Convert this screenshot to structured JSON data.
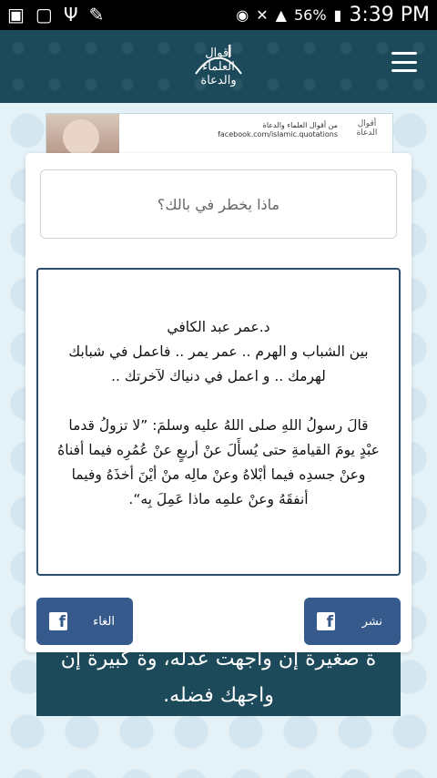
{
  "status_bar": {
    "left_icons": [
      "briefcase-icon",
      "chat-icon",
      "usb-icon",
      "pen-icon"
    ],
    "battery_percent": "56%",
    "time": "3:39 PM"
  },
  "header": {
    "logo_lines": [
      "أقوال",
      "العلماء",
      "والدعاة"
    ],
    "menu_icon": "hamburger-icon"
  },
  "banner": {
    "text_line1": "من أقوال العلماء والدعاة",
    "text_line2": "facebook.com/islamic.quotations",
    "logo_text": "أقوال الدعاة"
  },
  "composer": {
    "placeholder": "ماذا يخطر في بالك؟"
  },
  "post": {
    "text": "د.عمر عبد الكافي\nبين الشباب و الهرم .. عمر يمر .. فاعمل في شبابك لهرمك .. و اعمل في دنياك لآخرتك ..\n\nقالَ رسولُ اللهِ صلى اللهُ عليه وسلمَ: ”لا تزولُ قدما عبْدٍ يومَ القيامةِ حتى يُسأَلَ عنْ أربعٍ عنْ عُمُرِه فيما أفناهُ وعنْ جسدِه فيما أبْلاهُ وعنْ مالِه منْ أيْنَ أخذَهُ وفيما أنفقَهُ وعنْ علمِه ماذا عَمِلَ بِه“."
  },
  "background_panel": {
    "line1": "ة صغيرة إن واجهت عدله، وة كبيرة إن",
    "line2": "واجهك فضله."
  },
  "buttons": {
    "cancel_label": "الغاء",
    "share_label": "نشر"
  },
  "colors": {
    "header_bg": "#1d4a5a",
    "button_bg": "#375a8c",
    "textbox_border": "#2b4c6a"
  }
}
